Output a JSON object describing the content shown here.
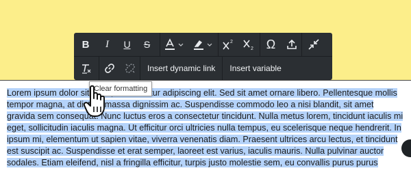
{
  "toolbar": {
    "row1": [
      {
        "name": "bold-button",
        "icon": "bold-icon",
        "glyph": "B"
      },
      {
        "name": "italic-button",
        "icon": "italic-icon",
        "glyph": "I"
      },
      {
        "name": "underline-button",
        "icon": "underline-icon",
        "glyph": "U"
      },
      {
        "name": "strikethrough-button",
        "icon": "strikethrough-icon",
        "glyph": "S"
      },
      {
        "name": "font-color-dropdown",
        "icon": "font-color-icon"
      },
      {
        "name": "highlight-color-dropdown",
        "icon": "highlighter-icon"
      },
      {
        "name": "superscript-button",
        "icon": "superscript-icon"
      },
      {
        "name": "subscript-button",
        "icon": "subscript-icon"
      },
      {
        "name": "special-character-button",
        "icon": "omega-icon",
        "glyph": "Ω"
      },
      {
        "name": "insert-upload-button",
        "icon": "upload-icon"
      },
      {
        "name": "collapse-button",
        "icon": "collapse-arrows-icon"
      }
    ],
    "insert_dynamic_link_label": "Insert dynamic link",
    "insert_variable_label": "Insert variable"
  },
  "tooltip": {
    "text": "Clear formatting"
  },
  "editor": {
    "paragraph": "Lorem ipsum dolor sit amet, consectetur adipiscing elit. Sed sit amet ornare libero. Pellentesque mollis tempor magna, at dictum massa dignissim ac. Suspendisse commodo leo a nisi blandit, sit amet gravida sem consequat. Nunc luctus eros a consectetur tincidunt. Nulla metus lorem, tincidunt iaculis mi eget, sollicitudin iaculis magna. Ut efficitur orci ultricies nulla tempus, eu scelerisque neque hendrerit. In ipsum mi, elementum ut sapien vitae, viverra venenatis diam. Praesent ultrices arcu lectus, et tincidunt est suscipit ac. Suspendisse et erat semper, laoreet est varius, iaculis mauris. Nulla pulvinar auctor sodales. Etiam eleifend, nisl a fringilla efficitur, turpis justo molestie sem, eu convallis purus purus"
  },
  "colors": {
    "page_background": "#fcee8a",
    "toolbar_background": "#2b2f33",
    "selection": "#b5d3fa"
  }
}
